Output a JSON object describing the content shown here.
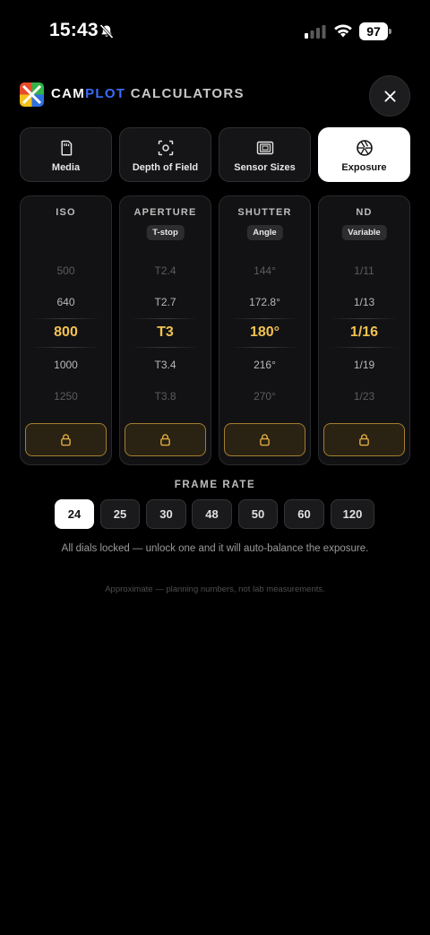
{
  "status_bar": {
    "time": "15:43",
    "battery": "97",
    "bell_icon": "bell-slash-icon",
    "signal_icon": "cellular-signal-icon",
    "wifi_icon": "wifi-icon"
  },
  "header": {
    "brand_part1": "CAM",
    "brand_part2": "PLOT",
    "brand_part3": " CALCULATORS",
    "brand_accent": "#3b6cf6",
    "close_icon": "close-icon"
  },
  "tabs": [
    {
      "label": "Media",
      "icon": "memory-card-icon",
      "active": false
    },
    {
      "label": "Depth of Field",
      "icon": "focus-icon",
      "active": false
    },
    {
      "label": "Sensor Sizes",
      "icon": "sensor-icon",
      "active": false
    },
    {
      "label": "Exposure",
      "icon": "aperture-icon",
      "active": true
    }
  ],
  "dials": [
    {
      "title": "ISO",
      "chip": "",
      "values": [
        "500",
        "640",
        "800",
        "1000",
        "1250"
      ],
      "lock_icon": "lock-icon"
    },
    {
      "title": "APERTURE",
      "chip": "T-stop",
      "values": [
        "T2.4",
        "T2.7",
        "T3",
        "T3.4",
        "T3.8"
      ],
      "lock_icon": "lock-icon"
    },
    {
      "title": "SHUTTER",
      "chip": "Angle",
      "values": [
        "144°",
        "172.8°",
        "180°",
        "216°",
        "270°"
      ],
      "lock_icon": "lock-icon"
    },
    {
      "title": "ND",
      "chip": "Variable",
      "values": [
        "1/11",
        "1/13",
        "1/16",
        "1/19",
        "1/23"
      ],
      "lock_icon": "lock-icon"
    }
  ],
  "accent_color": "#f1c24f",
  "frame_rate": {
    "title": "FRAME RATE",
    "options": [
      "24",
      "25",
      "30",
      "48",
      "50",
      "60",
      "120"
    ],
    "selected": "24"
  },
  "note": "All dials locked — unlock one and it will auto-balance the exposure.",
  "footnote": "Approximate — planning numbers, not lab measurements."
}
